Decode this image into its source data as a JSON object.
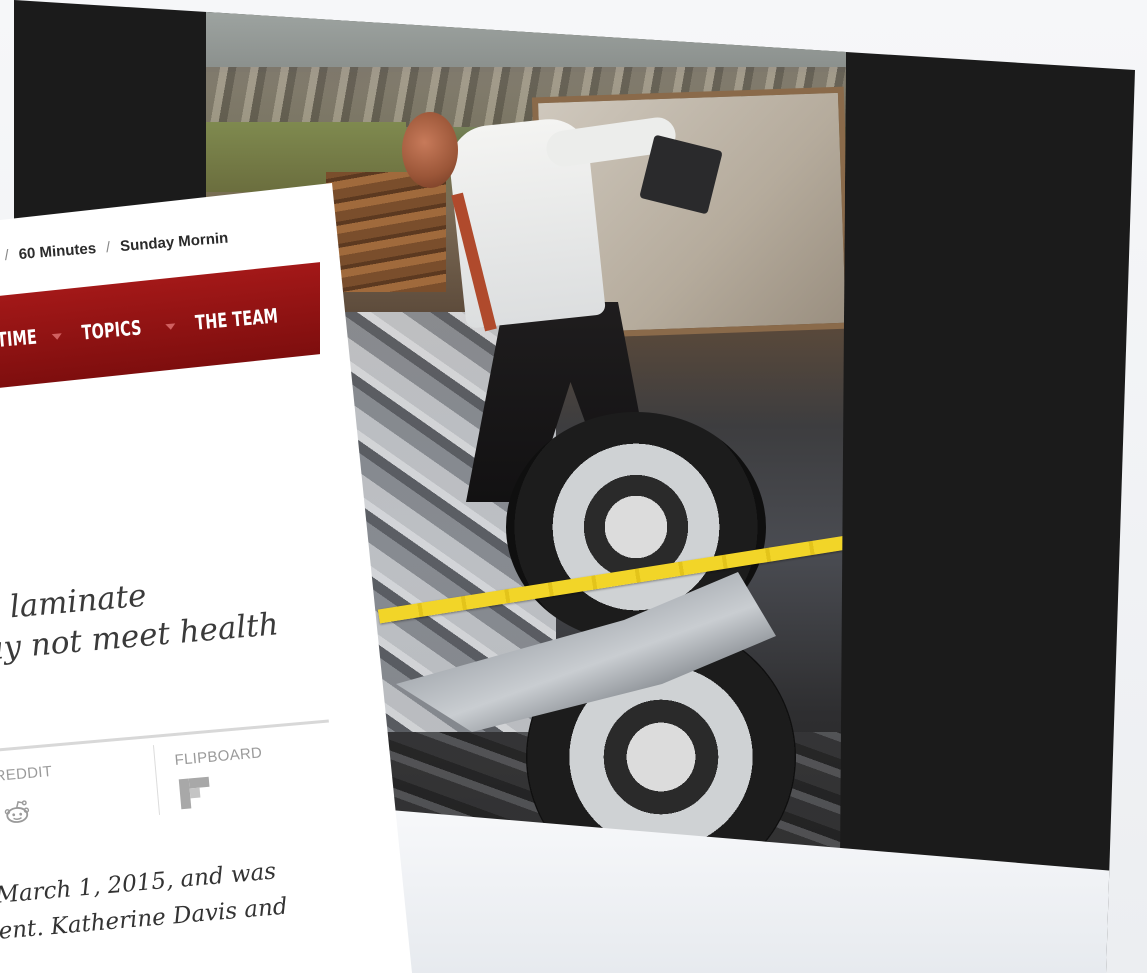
{
  "article": {
    "breadcrumb": [
      "60 Minutes",
      "Sunday Mornin"
    ],
    "nav": [
      "TIME",
      "TOPICS",
      "THE TEAM"
    ],
    "headline_lines": [
      "e laminate",
      "ay not meet health"
    ],
    "share": {
      "reddit_label": "REDDIT",
      "flipboard_label": "FLIPBOARD"
    },
    "body_lines": [
      "March 1, 2015, and was",
      "ent. Katherine Davis and"
    ]
  },
  "colors": {
    "nav_red": "#a31818",
    "photo_frame": "#1b1b1b"
  },
  "icons": {
    "reddit": "reddit-icon",
    "flipboard": "flipboard-icon"
  }
}
